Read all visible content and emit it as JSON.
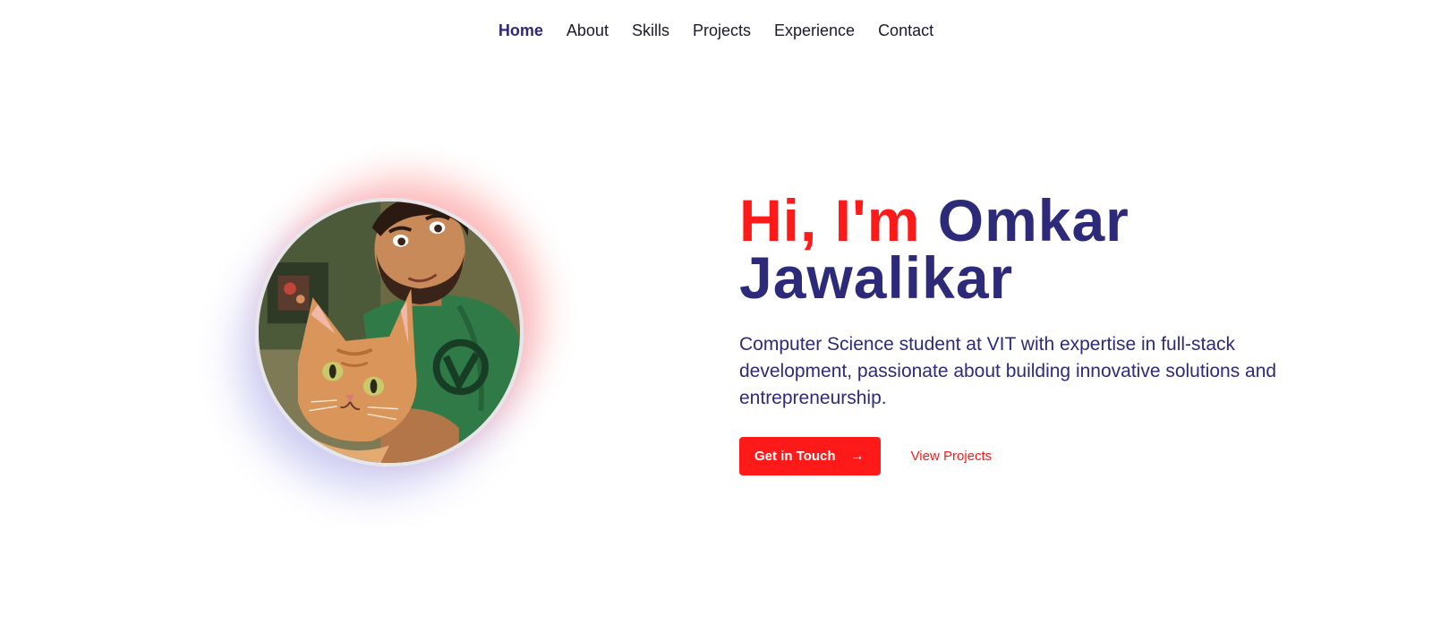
{
  "nav": {
    "items": [
      {
        "label": "Home",
        "active": true
      },
      {
        "label": "About"
      },
      {
        "label": "Skills"
      },
      {
        "label": "Projects"
      },
      {
        "label": "Experience"
      },
      {
        "label": "Contact"
      }
    ]
  },
  "hero": {
    "greeting": "Hi, I'm",
    "first_name": "Omkar",
    "last_name": "Jawalikar",
    "description": "Computer Science student at VIT with expertise in full-stack development, passionate about building innovative solutions and entrepreneurship.",
    "primary_button": "Get in Touch",
    "secondary_button": "View Projects"
  },
  "colors": {
    "accent_red": "#ff1a1a",
    "brand_navy": "#2e2a7a",
    "background": "#ffffff"
  },
  "icons": {
    "button_arrow": "arrow-right-icon"
  }
}
